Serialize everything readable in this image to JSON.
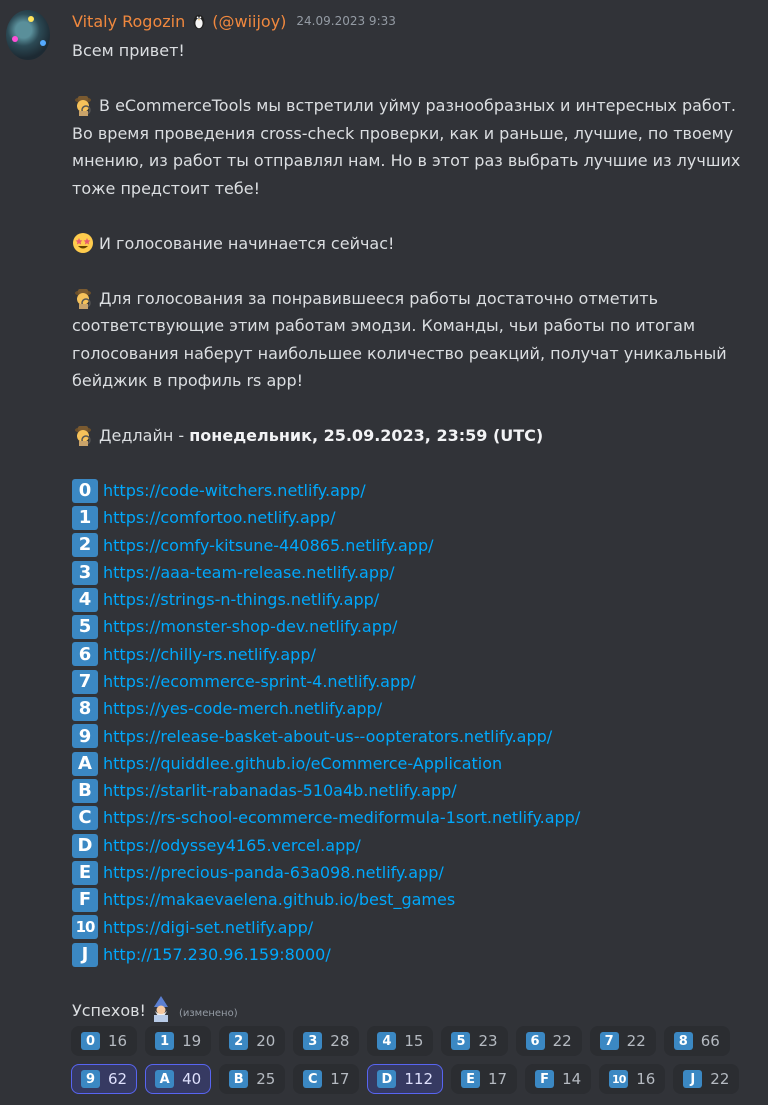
{
  "message": {
    "author": "Vitaly Rogozin",
    "handle": "(@wiijoy)",
    "timestamp": "24.09.2023 9:33",
    "greeting": "Всем привет!",
    "para1": [
      "В eCommerceTools мы встретили уйму разнообразных и интересных работ.",
      "Во время проведения cross-check проверки, как и раньше, лучшие, по твоему",
      "мнению, из работ ты отправлял нам. Но в этот раз выбрать лучшие из лучших",
      "тоже предстоит тебе!"
    ],
    "para2": "И голосование начинается сейчас!",
    "para3": [
      "Для голосования за понравившееся работы достаточно отметить",
      "соответствующие этим работам эмодзи. Команды, чьи работы по итогам",
      "голосования наберут наибольшее количество реакций, получат уникальный",
      "бейджик в профиль rs app!"
    ],
    "deadline_label": "Дедлайн - ",
    "deadline_value": "понедельник, 25.09.2023, 23:59 (UTC)",
    "links": [
      {
        "key": "0",
        "url": "https://code-witchers.netlify.app/"
      },
      {
        "key": "1",
        "url": "https://comfortoo.netlify.app/"
      },
      {
        "key": "2",
        "url": "https://comfy-kitsune-440865.netlify.app/"
      },
      {
        "key": "3",
        "url": "https://aaa-team-release.netlify.app/"
      },
      {
        "key": "4",
        "url": "https://strings-n-things.netlify.app/"
      },
      {
        "key": "5",
        "url": "https://monster-shop-dev.netlify.app/"
      },
      {
        "key": "6",
        "url": "https://chilly-rs.netlify.app/"
      },
      {
        "key": "7",
        "url": "https://ecommerce-sprint-4.netlify.app/"
      },
      {
        "key": "8",
        "url": "https://yes-code-merch.netlify.app/"
      },
      {
        "key": "9",
        "url": "https://release-basket-about-us--oopterators.netlify.app/"
      },
      {
        "key": "A",
        "url": "https://quiddlee.github.io/eCommerce-Application"
      },
      {
        "key": "B",
        "url": "https://starlit-rabanadas-510a4b.netlify.app/"
      },
      {
        "key": "C",
        "url": "https://rs-school-ecommerce-mediformula-1sort.netlify.app/"
      },
      {
        "key": "D",
        "url": "https://odyssey4165.vercel.app/"
      },
      {
        "key": "E",
        "url": "https://precious-panda-63a098.netlify.app/"
      },
      {
        "key": "F",
        "url": "https://makaevaelena.github.io/best_games"
      },
      {
        "key": "10",
        "url": "https://digi-set.netlify.app/"
      },
      {
        "key": "J",
        "url": "http://157.230.96.159:8000/"
      }
    ],
    "closing": "Успехов!",
    "edited": "(изменено)"
  },
  "reactions": [
    [
      {
        "key": "0",
        "count": "16",
        "active": false
      },
      {
        "key": "1",
        "count": "19",
        "active": false
      },
      {
        "key": "2",
        "count": "20",
        "active": false
      },
      {
        "key": "3",
        "count": "28",
        "active": false
      },
      {
        "key": "4",
        "count": "15",
        "active": false
      },
      {
        "key": "5",
        "count": "23",
        "active": false
      },
      {
        "key": "6",
        "count": "22",
        "active": false
      },
      {
        "key": "7",
        "count": "22",
        "active": false
      },
      {
        "key": "8",
        "count": "66",
        "active": false
      }
    ],
    [
      {
        "key": "9",
        "count": "62",
        "active": true
      },
      {
        "key": "A",
        "count": "40",
        "active": true
      },
      {
        "key": "B",
        "count": "25",
        "active": false
      },
      {
        "key": "C",
        "count": "17",
        "active": false
      },
      {
        "key": "D",
        "count": "112",
        "active": true
      },
      {
        "key": "E",
        "count": "17",
        "active": false
      },
      {
        "key": "F",
        "count": "14",
        "active": false
      },
      {
        "key": "10",
        "count": "16",
        "active": false
      },
      {
        "key": "J",
        "count": "22",
        "active": false
      }
    ]
  ],
  "colors": {
    "background": "#313338",
    "username": "#f0883e",
    "link": "#00a8fc",
    "keycap": "#3b88c3",
    "reaction_active_border": "#5865f2"
  },
  "icons": {
    "after_name": "penguin-emoji-icon",
    "para1": "detective-emoji-icon",
    "para2": "star-struck-emoji-icon",
    "para3": "detective-emoji-icon",
    "deadline": "detective-emoji-icon",
    "closing": "mage-emoji-icon"
  }
}
